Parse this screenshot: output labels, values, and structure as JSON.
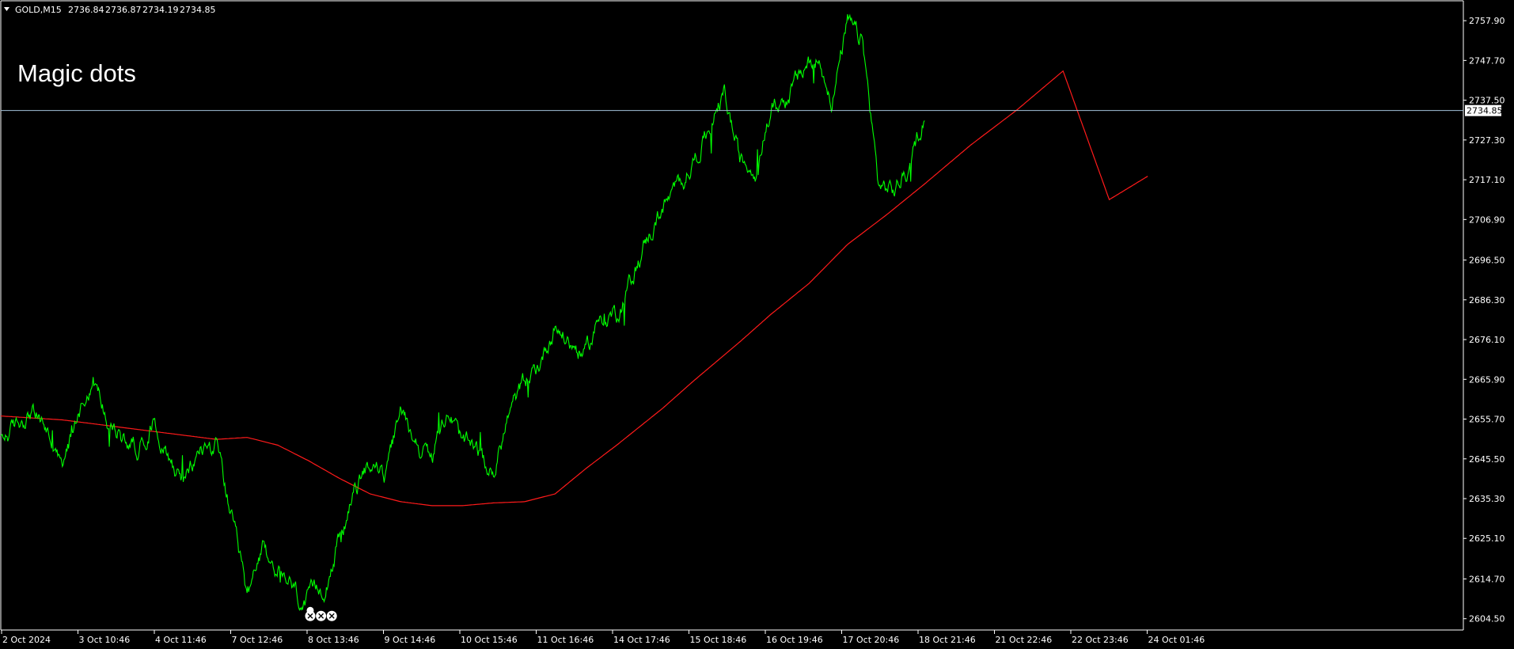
{
  "header": {
    "symbol": "GOLD,M15",
    "open": "2736.84",
    "high": "2736.87",
    "low": "2734.19",
    "close": "2734.85"
  },
  "overlay_text": "Magic dots",
  "colors": {
    "background": "#000000",
    "price_line": "#00ff00",
    "moving_average": "#ff1a1a",
    "bid_line": "#a3c3d9",
    "axis": "#ffffff",
    "dots": "#ffffff"
  },
  "chart_data": {
    "type": "line",
    "title": "",
    "xlabel": "",
    "ylabel": "",
    "ylim": [
      2601.6,
      2763.0
    ],
    "current_price": 2734.85,
    "current_price_label": "2734.85",
    "y_ticks": [
      "2757.90",
      "2747.70",
      "2737.50",
      "2727.30",
      "2717.10",
      "2706.90",
      "2696.50",
      "2686.30",
      "2676.10",
      "2665.90",
      "2655.70",
      "2645.50",
      "2635.30",
      "2625.10",
      "2614.70",
      "2604.50"
    ],
    "x_ticks": [
      "2 Oct 2024",
      "3 Oct 10:46",
      "4 Oct 11:46",
      "7 Oct 12:46",
      "8 Oct 13:46",
      "9 Oct 14:46",
      "10 Oct 15:46",
      "11 Oct 16:46",
      "14 Oct 17:46",
      "15 Oct 18:46",
      "16 Oct 19:46",
      "17 Oct 20:46",
      "18 Oct 21:46",
      "21 Oct 22:46",
      "22 Oct 23:46",
      "24 Oct 01:46"
    ],
    "series": [
      {
        "kind": "close",
        "bar_index": [
          0,
          20,
          40,
          60,
          80,
          100,
          120,
          140,
          160,
          180,
          200,
          220,
          240,
          260,
          280,
          300,
          320,
          340,
          360,
          380,
          395,
          400,
          420,
          440,
          460,
          480,
          500,
          520,
          540,
          560,
          580,
          600,
          620,
          640,
          660,
          680,
          700,
          720,
          740,
          760,
          780,
          800,
          820,
          840,
          860,
          880,
          900,
          920,
          940,
          960,
          980,
          1000,
          1020,
          1040,
          1060,
          1080,
          1100,
          1120,
          1140,
          1160,
          1180,
          1200,
          1220,
          1240,
          1260,
          1280,
          1300,
          1320,
          1340,
          1360,
          1380,
          1398,
          1410,
          1420,
          1440,
          1460,
          1480,
          1490
        ],
        "values": [
          2650,
          2654,
          2658,
          2653,
          2642,
          2658,
          2666,
          2655,
          2650,
          2649,
          2656,
          2645,
          2640,
          2648,
          2649,
          2630,
          2610,
          2621,
          2617,
          2612,
          2607,
          2609,
          2613,
          2625,
          2637,
          2645,
          2641,
          2658,
          2650,
          2645,
          2659,
          2649,
          2647,
          2641,
          2657,
          2665,
          2670,
          2680,
          2675,
          2672,
          2683,
          2683,
          2692,
          2702,
          2710,
          2715,
          2722,
          2730,
          2739,
          2722,
          2720,
          2735,
          2738,
          2744,
          2749,
          2738,
          2757,
          2752,
          2716,
          2714,
          2720,
          2734
        ]
      },
      {
        "kind": "moving_average",
        "bar_index": [
          0,
          80,
          160,
          240,
          280,
          320,
          360,
          400,
          440,
          480,
          520,
          560,
          600,
          640,
          680,
          720,
          760,
          800,
          860,
          900,
          960,
          1000,
          1050,
          1100,
          1150,
          1200,
          1260,
          1320,
          1380,
          1440,
          1490
        ],
        "values": [
          2656.5,
          2655.5,
          2653.5,
          2651.5,
          2650.5,
          2651,
          2649,
          2645,
          2640.5,
          2636.5,
          2634.5,
          2633.5,
          2633.5,
          2634.2,
          2634.5,
          2636.5,
          2643,
          2649,
          2658.5,
          2665.5,
          2675.5,
          2682.5,
          2690.5,
          2700.5,
          2708,
          2716,
          2726,
          2735,
          2745,
          2712,
          2718
        ]
      }
    ],
    "marker_bar_index": [
      402,
      416,
      430
    ]
  }
}
